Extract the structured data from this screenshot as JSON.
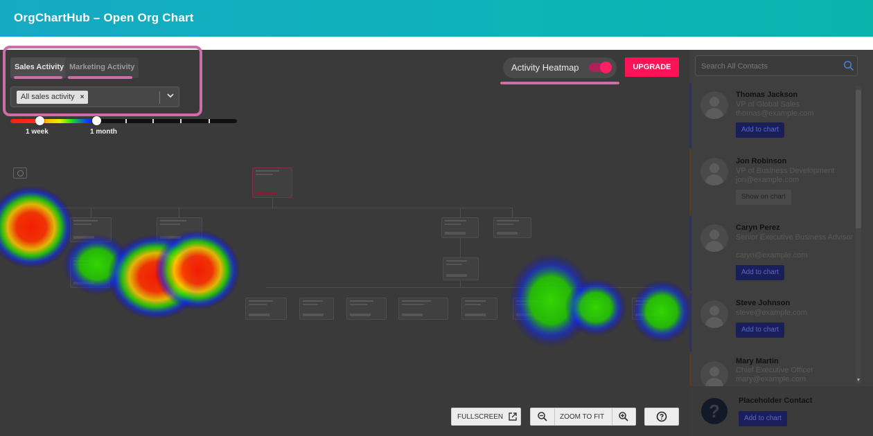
{
  "app": {
    "title": "OrgChartHub – Open Org Chart"
  },
  "colors": {
    "accent": "#ff1357",
    "highlight": "#cc6ea8",
    "header_from": "#16a9c4",
    "header_to": "#08b5ad"
  },
  "tabs": [
    {
      "label": "Sales Activity",
      "active": true
    },
    {
      "label": "Marketing Activity",
      "active": false
    }
  ],
  "filter": {
    "chip_label": "All sales activity",
    "chip_remove": "×",
    "dropdown_icon": "chevron-down-icon"
  },
  "time_slider": {
    "labels": [
      "1 week",
      "1 month"
    ]
  },
  "heatmap_toggle": {
    "label": "Activity Heatmap",
    "enabled": true
  },
  "upgrade_label": "UPGRADE",
  "controls": {
    "fullscreen": "FULLSCREEN",
    "zoom_to_fit": "ZOOM TO FIT"
  },
  "sidebar": {
    "search_placeholder": "Search All Contacts",
    "contacts": [
      {
        "name": "Thomas Jackson",
        "role": "VP of Global Sales",
        "email": "thomas@example.com",
        "action": "Add to chart"
      },
      {
        "name": "Jon Robinson",
        "role": "VP of Business Development",
        "email": "jon@example.com",
        "action": "Show on chart"
      },
      {
        "name": "Caryn Perez",
        "role": "Senior Executive Business Advisor",
        "email": "caryn@example.com",
        "action": "Add to chart"
      },
      {
        "name": "Steve Johnson",
        "role": "",
        "email": "steve@example.com",
        "action": "Add to chart"
      },
      {
        "name": "Mary Martin",
        "role": "Chief Executive Officer",
        "email": "mary@example.com",
        "action": ""
      }
    ],
    "placeholder": {
      "name": "Placeholder Contact",
      "action": "Add to chart"
    }
  }
}
